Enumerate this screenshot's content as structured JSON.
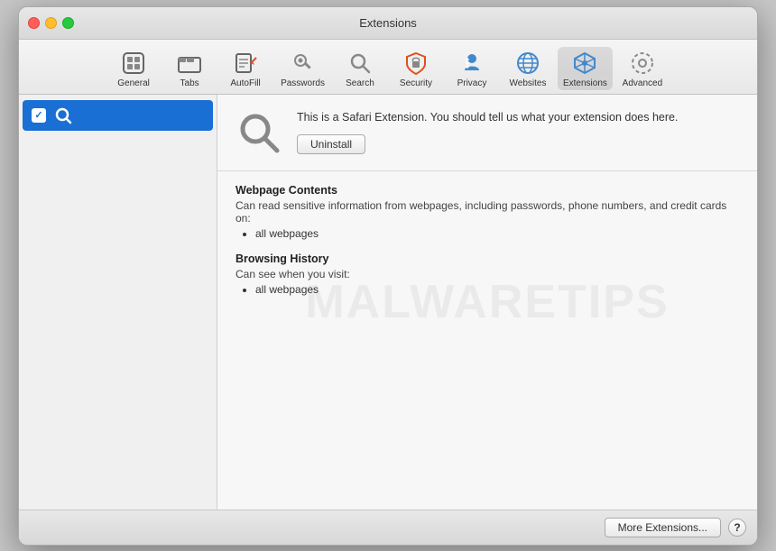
{
  "window": {
    "title": "Extensions"
  },
  "toolbar": {
    "items": [
      {
        "id": "general",
        "label": "General",
        "icon": "general-icon"
      },
      {
        "id": "tabs",
        "label": "Tabs",
        "icon": "tabs-icon"
      },
      {
        "id": "autofill",
        "label": "AutoFill",
        "icon": "autofill-icon"
      },
      {
        "id": "passwords",
        "label": "Passwords",
        "icon": "passwords-icon"
      },
      {
        "id": "search",
        "label": "Search",
        "icon": "search-icon"
      },
      {
        "id": "security",
        "label": "Security",
        "icon": "security-icon"
      },
      {
        "id": "privacy",
        "label": "Privacy",
        "icon": "privacy-icon"
      },
      {
        "id": "websites",
        "label": "Websites",
        "icon": "websites-icon"
      },
      {
        "id": "extensions",
        "label": "Extensions",
        "icon": "extensions-icon"
      },
      {
        "id": "advanced",
        "label": "Advanced",
        "icon": "advanced-icon"
      }
    ]
  },
  "sidebar": {
    "items": [
      {
        "id": "search-ext",
        "label": "",
        "enabled": true
      }
    ]
  },
  "extension": {
    "description": "This is a Safari Extension. You should tell us what your extension does here.",
    "uninstall_label": "Uninstall",
    "permissions": [
      {
        "title": "Webpage Contents",
        "description": "Can read sensitive information from webpages, including passwords, phone numbers, and credit cards on:",
        "items": [
          "all webpages"
        ]
      },
      {
        "title": "Browsing History",
        "description": "Can see when you visit:",
        "items": [
          "all webpages"
        ]
      }
    ]
  },
  "footer": {
    "more_extensions_label": "More Extensions...",
    "help_label": "?"
  },
  "watermark": {
    "text": "MALWARETIPS"
  },
  "colors": {
    "accent": "#1a6fd4",
    "selected_bg": "#1a6fd4"
  }
}
